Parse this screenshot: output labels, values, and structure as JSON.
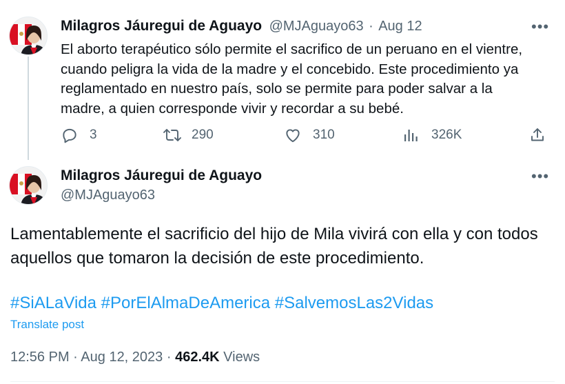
{
  "tweet1": {
    "author_name": "Milagros Jáuregui de Aguayo",
    "author_handle": "@MJAguayo63",
    "separator": "·",
    "date": "Aug 12",
    "text_lines": [
      "El aborto terapéutico sólo permite el sacrifico de un peruano en el vientre,",
      "cuando peligra la vida de la madre y el concebido. Este procedimiento ya",
      "reglamentado en nuestro país, solo se permite para poder salvar a la",
      "madre, a quien corresponde vivir y recordar a su bebé."
    ],
    "metrics": {
      "replies": "3",
      "retweets": "290",
      "likes": "310",
      "views": "326K"
    },
    "more_icon": "ellipsis-icon"
  },
  "tweet2": {
    "author_name": "Milagros Jáuregui de Aguayo",
    "author_handle": "@MJAguayo63",
    "text_lines": [
      "Lamentablemente el sacrificio del hijo de Mila vivirá con ella y con todos",
      "aquellos que tomaron la decisión de este procedimiento."
    ],
    "hashtags": [
      "#SiALaVida",
      "#PorElAlmaDeAmerica",
      "#SalvemosLas2Vidas"
    ],
    "translate_label": "Translate post",
    "time": "12:56 PM",
    "separator": "·",
    "full_date": "Aug 12, 2023",
    "view_count": "462.4K",
    "views_label": "Views"
  },
  "colors": {
    "link": "#1d9bf0",
    "secondary_text": "#536471",
    "primary_text": "#0f1419"
  }
}
